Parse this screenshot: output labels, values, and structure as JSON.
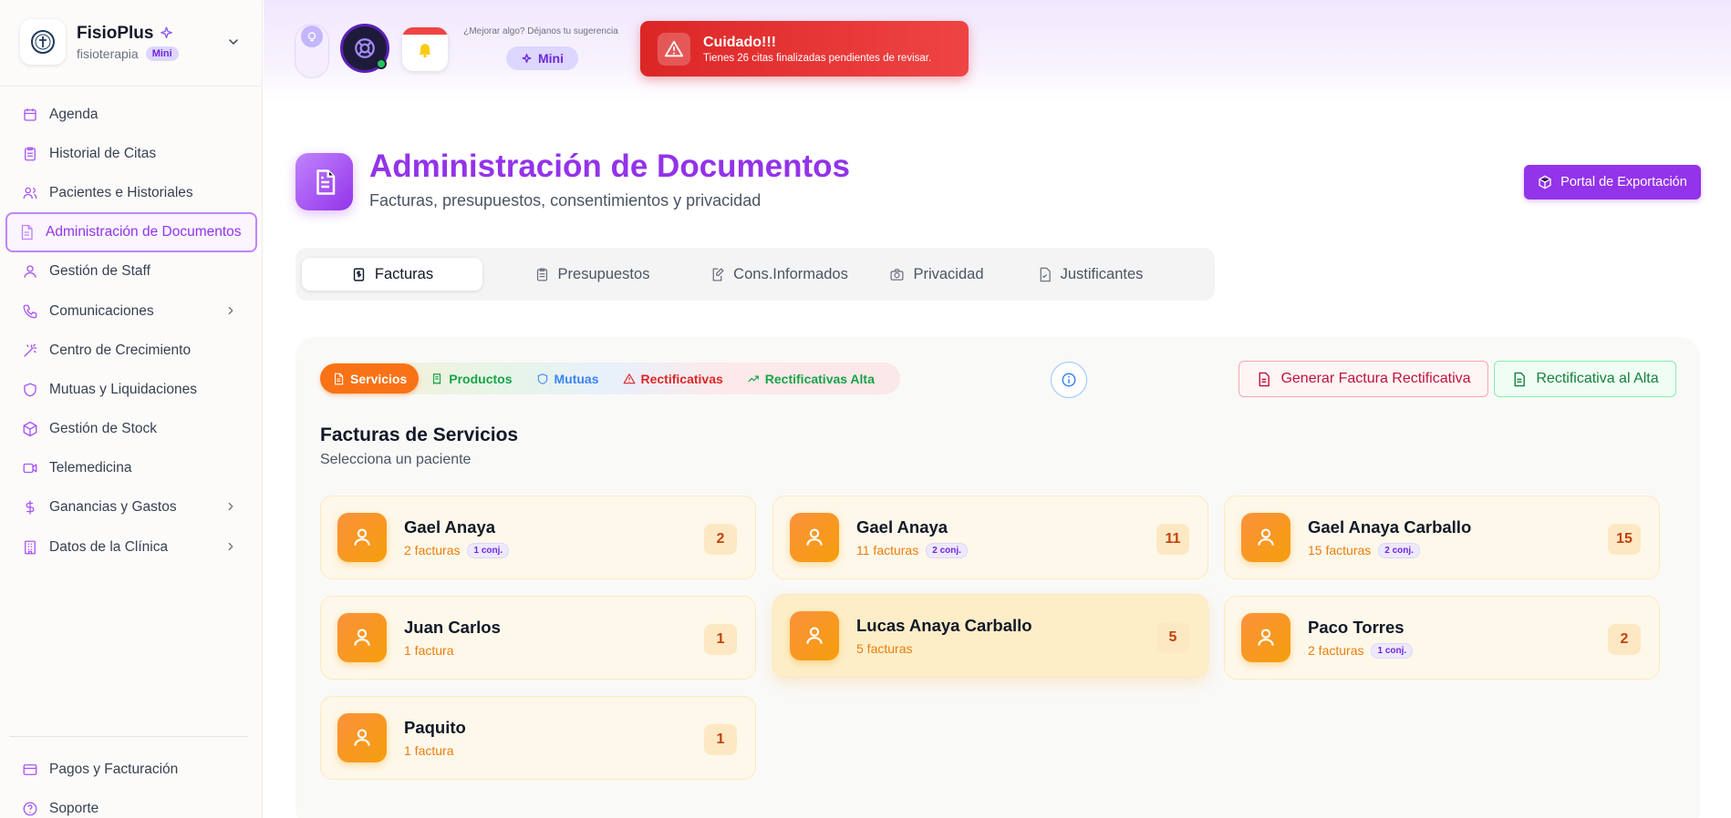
{
  "brand": {
    "name": "FisioPlus",
    "subtitle": "fisioterapia",
    "badge": "Mini"
  },
  "sidebar": {
    "items": [
      {
        "label": "Agenda",
        "icon": "calendar-icon"
      },
      {
        "label": "Historial de Citas",
        "icon": "clipboard-icon"
      },
      {
        "label": "Pacientes e Historiales",
        "icon": "users-icon"
      },
      {
        "label": "Administración de Documentos",
        "icon": "document-icon",
        "active": true
      },
      {
        "label": "Gestión de Staff",
        "icon": "user-icon"
      },
      {
        "label": "Comunicaciones",
        "icon": "phone-icon",
        "has_submenu": true
      },
      {
        "label": "Centro de Crecimiento",
        "icon": "wand-icon"
      },
      {
        "label": "Mutuas y Liquidaciones",
        "icon": "shield-icon"
      },
      {
        "label": "Gestión de Stock",
        "icon": "package-icon"
      },
      {
        "label": "Telemedicina",
        "icon": "video-icon"
      },
      {
        "label": "Ganancias y Gastos",
        "icon": "dollar-icon",
        "has_submenu": true
      },
      {
        "label": "Datos de la Clínica",
        "icon": "building-icon",
        "has_submenu": true
      }
    ],
    "footer_items": [
      {
        "label": "Pagos y Facturación",
        "icon": "credit-card-icon"
      },
      {
        "label": "Soporte",
        "icon": "help-icon"
      }
    ]
  },
  "topbar": {
    "suggestion_text": "¿Mejorar algo? Déjanos tu sugerencia",
    "suggestion_button": "Mini",
    "alert": {
      "title": "Cuidado!!!",
      "message": "Tienes 26 citas finalizadas pendientes de revisar."
    }
  },
  "page": {
    "title": "Administración de Documentos",
    "subtitle": "Facturas, presupuestos, consentimientos y privacidad",
    "export_button": "Portal de Exportación"
  },
  "tabs": [
    {
      "label": "Facturas",
      "icon": "invoice-icon",
      "active": true
    },
    {
      "label": "Presupuestos",
      "icon": "clipboard-icon"
    },
    {
      "label": "Cons.Informados",
      "icon": "edit-document-icon"
    },
    {
      "label": "Privacidad",
      "icon": "camera-icon"
    },
    {
      "label": "Justificantes",
      "icon": "file-check-icon"
    }
  ],
  "subtabs": [
    {
      "label": "Servicios",
      "icon": "document-icon",
      "color": "#ffffff",
      "active": true
    },
    {
      "label": "Productos",
      "icon": "receipt-icon",
      "color": "#16a34a"
    },
    {
      "label": "Mutuas",
      "icon": "shield-icon",
      "color": "#3b82f6"
    },
    {
      "label": "Rectificativas",
      "icon": "warning-icon",
      "color": "#dc2626"
    },
    {
      "label": "Rectificativas Alta",
      "icon": "trending-up-icon",
      "color": "#16a34a"
    }
  ],
  "actions": {
    "generate_rect": "Generar Factura Rectificativa",
    "rect_alta": "Rectificativa al Alta"
  },
  "section": {
    "title": "Facturas de Servicios",
    "subtitle": "Selecciona un paciente"
  },
  "patients": [
    {
      "name": "Gael Anaya",
      "invoices": "2 facturas",
      "conj": "1 conj.",
      "count": "2"
    },
    {
      "name": "Gael Anaya",
      "invoices": "11 facturas",
      "conj": "2 conj.",
      "count": "11"
    },
    {
      "name": "Gael Anaya Carballo",
      "invoices": "15 facturas",
      "conj": "2 conj.",
      "count": "15"
    },
    {
      "name": "Juan Carlos",
      "invoices": "1 factura",
      "conj": "",
      "count": "1"
    },
    {
      "name": "Lucas Anaya Carballo",
      "invoices": "5 facturas",
      "conj": "",
      "count": "5"
    },
    {
      "name": "Paco Torres",
      "invoices": "2 facturas",
      "conj": "1 conj.",
      "count": "2"
    },
    {
      "name": "Paquito",
      "invoices": "1 factura",
      "conj": "",
      "count": "1"
    }
  ],
  "colors": {
    "accent": "#9333ea",
    "orange": "#f97316",
    "alert": "#dc2626"
  }
}
